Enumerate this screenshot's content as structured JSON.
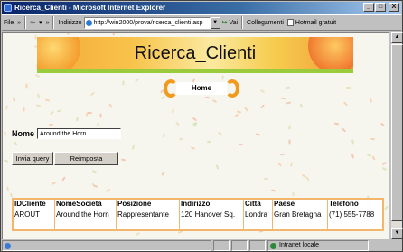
{
  "window": {
    "title": "Ricerca_Clienti - Microsoft Internet Explorer",
    "minimize": "_",
    "maximize": "□",
    "close": "X"
  },
  "toolbar": {
    "file_menu": "File",
    "chevron": "»",
    "back": "⇦",
    "back_dropdown": "▾",
    "address_label": "Indirizzo",
    "address_value": "http://win2000/prova/ricerca_clienti.asp",
    "go_label": "Vai",
    "links_label": "Collegamenti",
    "hotmail_label": "Hotmail gratuit"
  },
  "page": {
    "banner_title": "Ricerca_Clienti",
    "home_label": "Home",
    "form": {
      "name_label": "Nome",
      "name_value": "Around the Horn",
      "submit_label": "Invia query",
      "reset_label": "Reimposta"
    },
    "table": {
      "headers": [
        "IDCliente",
        "NomeSocietà",
        "Posizione",
        "Indirizzo",
        "Città",
        "Paese",
        "Telefono"
      ],
      "rows": [
        [
          "AROUT",
          "Around the Horn",
          "Rappresentante",
          "120 Hanover Sq.",
          "Londra",
          "Gran Bretagna",
          "(71) 555-7788"
        ]
      ]
    }
  },
  "statusbar": {
    "zone_label": "Intranet locale"
  },
  "colors": {
    "title_bar": "#0a246a",
    "table_border": "#f3b66a",
    "home_arc": "#f29a1e",
    "banner_green": "#9acb3c"
  }
}
